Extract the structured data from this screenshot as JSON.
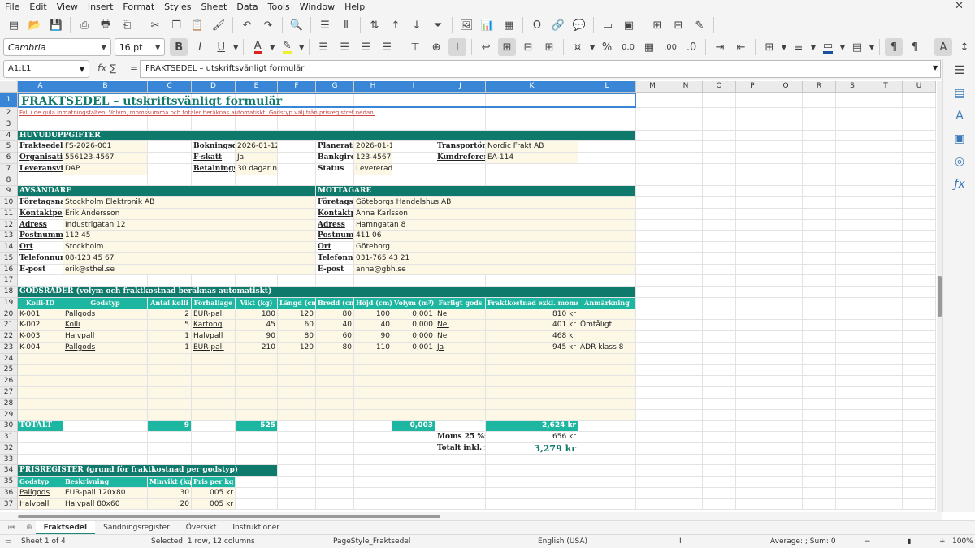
{
  "menu": [
    "File",
    "Edit",
    "View",
    "Insert",
    "Format",
    "Styles",
    "Sheet",
    "Data",
    "Tools",
    "Window",
    "Help"
  ],
  "close_glyph": "✕",
  "toolbar1": [
    "new-icon",
    "open-icon",
    "save-icon",
    "export-pdf-icon",
    "print-icon",
    "print-preview-icon",
    "cut-icon",
    "copy-icon",
    "paste-icon",
    "clone-format-icon",
    "undo-icon",
    "redo-icon",
    "find-icon",
    "row-icon",
    "column-icon",
    "sort-icon",
    "sort-asc-icon",
    "sort-desc-icon",
    "autofilter-icon",
    "image-icon",
    "chart-icon",
    "pivot-icon",
    "special-char-icon",
    "hyperlink-icon",
    "comment-icon",
    "header-footer-icon",
    "define-print-area-icon",
    "freeze-icon",
    "split-icon",
    "show-draw-icon"
  ],
  "font_name": "Cambria",
  "font_size": "16 pt",
  "toolbar2": {
    "bold": "B",
    "italic": "I",
    "underline": "U",
    "currency": "%",
    "num1": "0.0",
    "num2": ".00"
  },
  "namebox": "A1:L1",
  "fx_glyph": "fx",
  "sum_glyph": "∑",
  "eq_glyph": "=",
  "formula": "FRAKTSEDEL – utskriftsvänligt formulär",
  "columns": [
    "A",
    "B",
    "C",
    "D",
    "E",
    "F",
    "G",
    "H",
    "I",
    "J",
    "K",
    "L",
    "M",
    "N",
    "O",
    "P",
    "Q",
    "R",
    "S",
    "T",
    "U"
  ],
  "rows": [
    "1",
    "2",
    "3",
    "4",
    "5",
    "6",
    "7",
    "8",
    "9",
    "10",
    "11",
    "12",
    "13",
    "14",
    "15",
    "16",
    "17",
    "18",
    "19",
    "20",
    "21",
    "22",
    "23",
    "24",
    "25",
    "26",
    "27",
    "28",
    "29",
    "30",
    "31",
    "32",
    "33",
    "34",
    "35",
    "36",
    "37"
  ],
  "colors": {
    "teal": "#0f7a6b",
    "teal_light": "#1db6a0",
    "cream": "#fdf8e6",
    "select": "#3a86d6"
  },
  "cells": {
    "title": "FRAKTSEDEL – utskriftsvänligt formulär",
    "subtitle": "Fyll i de gula inmatningsfälten. Volym, momssumma och totaler beräknas automatiskt. Godstyp välj från prisregistret nedan.",
    "s_huvud": "HUVUDUPPGIFTER",
    "r5": [
      "Fraktsedelsnr",
      "FS-2026-001",
      "Bokningsdatum",
      "2026-01-12",
      "Planerat",
      "2026-01-15",
      "Transportör",
      "Nordic Frakt AB"
    ],
    "r6": [
      "Organisationsnr",
      "556123-4567",
      "F-skatt",
      "Ja",
      "Bankgiro",
      "123-4567",
      "Kundreferens",
      "EA-114"
    ],
    "r7": [
      "Leveransvillkor",
      "DAP",
      "Betalningsvillkor",
      "30 dagar netto",
      "Status",
      "Levererad"
    ],
    "s_avs": "AVSÄNDARE",
    "s_mot": "MOTTAGARE",
    "r10": [
      "Företagsnamn",
      "Stockholm Elektronik AB",
      "Företagsnamn",
      "Göteborgs Handelshus AB"
    ],
    "r11": [
      "Kontaktperson",
      "Erik Andersson",
      "Kontaktperson",
      "Anna Karlsson"
    ],
    "r12": [
      "Adress",
      "Industrigatan 12",
      "Adress",
      "Hamngatan 8"
    ],
    "r13": [
      "Postnummer",
      "112 45",
      "Postnummer",
      "411 06"
    ],
    "r14": [
      "Ort",
      "Stockholm",
      "Ort",
      "Göteborg"
    ],
    "r15": [
      "Telefonnummer",
      "08-123 45 67",
      "Telefonnummer",
      "031-765 43 21"
    ],
    "r16": [
      "E-post",
      "erik@sthel.se",
      "E-post",
      "anna@gbh.se"
    ],
    "s_gods": "GODSRADER (volym och fraktkostnad beräknas automatiskt)",
    "hdr19": [
      "Kolli-ID",
      "Godstyp",
      "Antal kolli",
      "Förhallage",
      "Vikt (kg)",
      "Längd (cm)",
      "Bredd (cm)",
      "Höjd (cm)",
      "Volym (m³)",
      "Farligt gods",
      "Fraktkostnad exkl. moms",
      "Anmärkning"
    ],
    "goods": [
      [
        "K-001",
        "Pallgods",
        "2",
        "EUR-pall",
        "180",
        "120",
        "80",
        "100",
        "0,001",
        "Nej",
        "810 kr",
        ""
      ],
      [
        "K-002",
        "Kolli",
        "5",
        "Kartong",
        "45",
        "60",
        "40",
        "40",
        "0,000",
        "Nej",
        "401 kr",
        "Ömtåligt"
      ],
      [
        "K-003",
        "Halvpall",
        "1",
        "Halvpall",
        "90",
        "80",
        "60",
        "90",
        "0,000",
        "Nej",
        "468 kr",
        ""
      ],
      [
        "K-004",
        "Pallgods",
        "1",
        "EUR-pall",
        "210",
        "120",
        "80",
        "110",
        "0,001",
        "Ja",
        "945 kr",
        "ADR klass 8"
      ]
    ],
    "total_label": "TOTALT",
    "total_kolli": "9",
    "total_vikt": "525",
    "total_vol": "0,003",
    "total_kost": "2,624 kr",
    "moms_label": "Moms 25 %:",
    "moms_val": "656 kr",
    "tot_label": "Totalt inkl. moms",
    "tot_val": "3,279 kr",
    "s_pris": "PRISREGISTER (grund för fraktkostnad per godstyp)",
    "hdr35": [
      "Godstyp",
      "Beskrivning",
      "Minvikt (kg)",
      "Pris per kg (kr)"
    ],
    "prices": [
      [
        "Pallgods",
        "EUR-pall 120x80",
        "30",
        "005 kr"
      ],
      [
        "Halvpall",
        "Halvpall 80x60",
        "20",
        "005 kr"
      ]
    ]
  },
  "sheets": [
    "Fraktsedel",
    "Sändningsregister",
    "Översikt",
    "Instruktioner"
  ],
  "status": {
    "sheet": "Sheet 1 of 4",
    "selection": "Selected: 1 row, 12 columns",
    "pagestyle": "PageStyle_Fraktsedel",
    "lang": "English (USA)",
    "sum": "Average: ; Sum: 0",
    "zoom": "100%"
  }
}
